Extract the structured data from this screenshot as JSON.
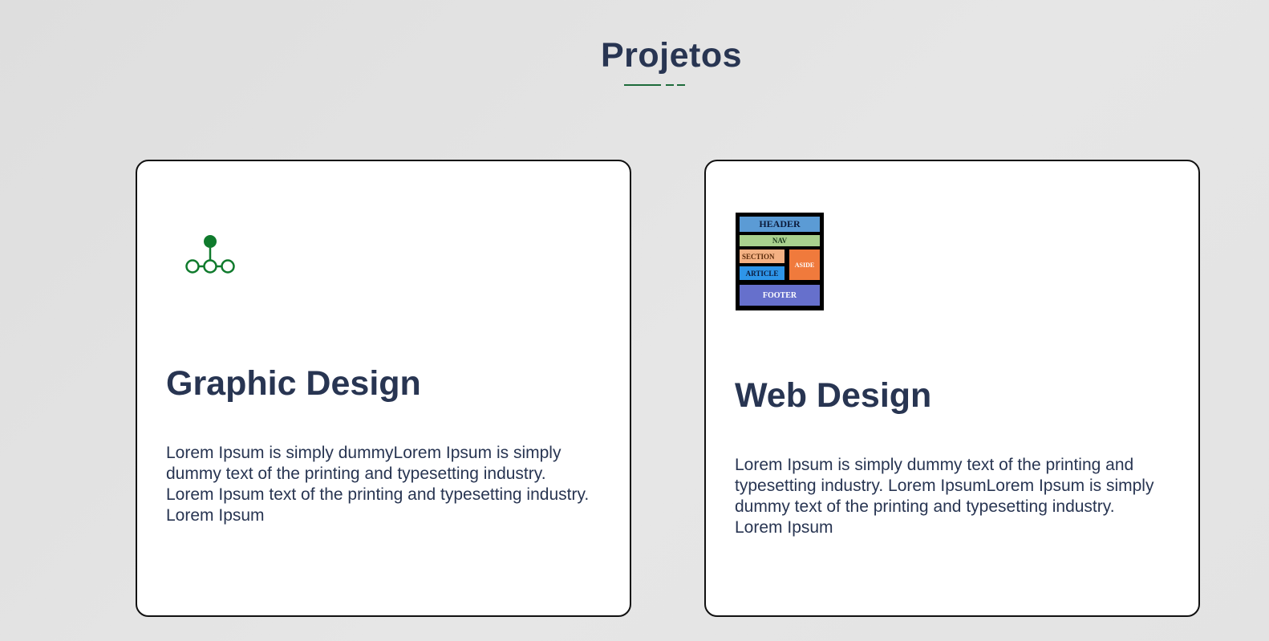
{
  "section": {
    "title": "Projetos",
    "accent_color": "#1d6b3a",
    "text_color": "#283552"
  },
  "cards": [
    {
      "icon": "network-icon",
      "title": "Graphic Design",
      "description": "Lorem Ipsum is simply dummyLorem Ipsum is simply dummy text of the printing and typesetting industry. Lorem Ipsum text of the printing and typesetting industry. Lorem Ipsum"
    },
    {
      "icon": "web-layout-icon",
      "title": "Web Design",
      "description": "Lorem Ipsum is simply dummy text of the printing and typesetting industry. Lorem IpsumLorem Ipsum is simply dummy text of the printing and typesetting industry. Lorem Ipsum",
      "layout_labels": {
        "header": "HEADER",
        "nav": "NAV",
        "section": "SECTION",
        "article": "ARTICLE",
        "aside": "ASIDE",
        "footer": "FOOTER"
      }
    }
  ]
}
